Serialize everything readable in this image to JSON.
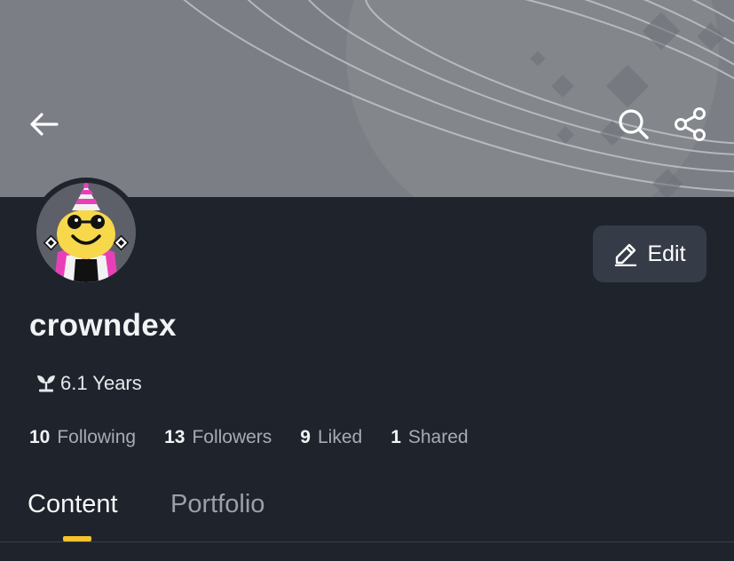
{
  "header": {
    "back_icon": "arrow-left-icon",
    "search_icon": "search-icon",
    "share_icon": "share-icon"
  },
  "profile": {
    "username": "crowndex",
    "age_icon": "sprout-icon",
    "age": "6.1 Years",
    "edit_label": "Edit",
    "edit_icon": "pencil-icon"
  },
  "stats": [
    {
      "count": "10",
      "label": "Following"
    },
    {
      "count": "13",
      "label": "Followers"
    },
    {
      "count": "9",
      "label": "Liked"
    },
    {
      "count": "1",
      "label": "Shared"
    }
  ],
  "tabs": [
    {
      "label": "Content",
      "active": true
    },
    {
      "label": "Portfolio",
      "active": false
    }
  ],
  "colors": {
    "background": "#1f242c",
    "banner": "#7b7e84",
    "accent": "#f6c32c",
    "button": "#363c47"
  }
}
